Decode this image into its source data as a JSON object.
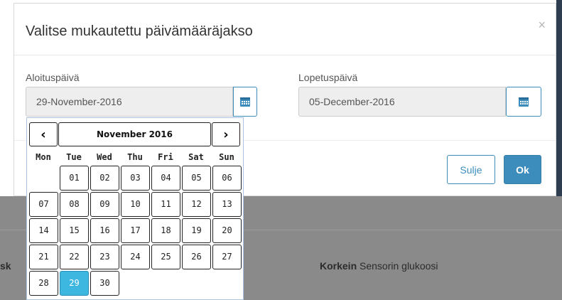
{
  "modal": {
    "title": "Valitse mukautettu päivämääräjakso",
    "close_glyph": "×",
    "start": {
      "label": "Aloituspäivä",
      "value": "29-November-2016"
    },
    "end": {
      "label": "Lopetuspäivä",
      "value": "05-December-2016"
    },
    "buttons": {
      "close": "Sulje",
      "ok": "Ok"
    }
  },
  "calendar": {
    "prev_glyph": "‹",
    "next_glyph": "›",
    "month_label": "November 2016",
    "weekdays": [
      "Mon",
      "Tue",
      "Wed",
      "Thu",
      "Fri",
      "Sat",
      "Sun"
    ],
    "first_weekday_offset": 1,
    "days": [
      "01",
      "02",
      "03",
      "04",
      "05",
      "06",
      "07",
      "08",
      "09",
      "10",
      "11",
      "12",
      "13",
      "14",
      "15",
      "16",
      "17",
      "18",
      "19",
      "20",
      "21",
      "22",
      "23",
      "24",
      "25",
      "26",
      "27",
      "28",
      "29",
      "30"
    ],
    "selected_day": "29",
    "selected_color": "#3db6e0"
  },
  "background": {
    "left_fragment": "sk",
    "right_label_bold": "Korkein",
    "right_label_rest": " Sensorin glukoosi"
  },
  "theme": {
    "accent": "#3c8dbc"
  }
}
